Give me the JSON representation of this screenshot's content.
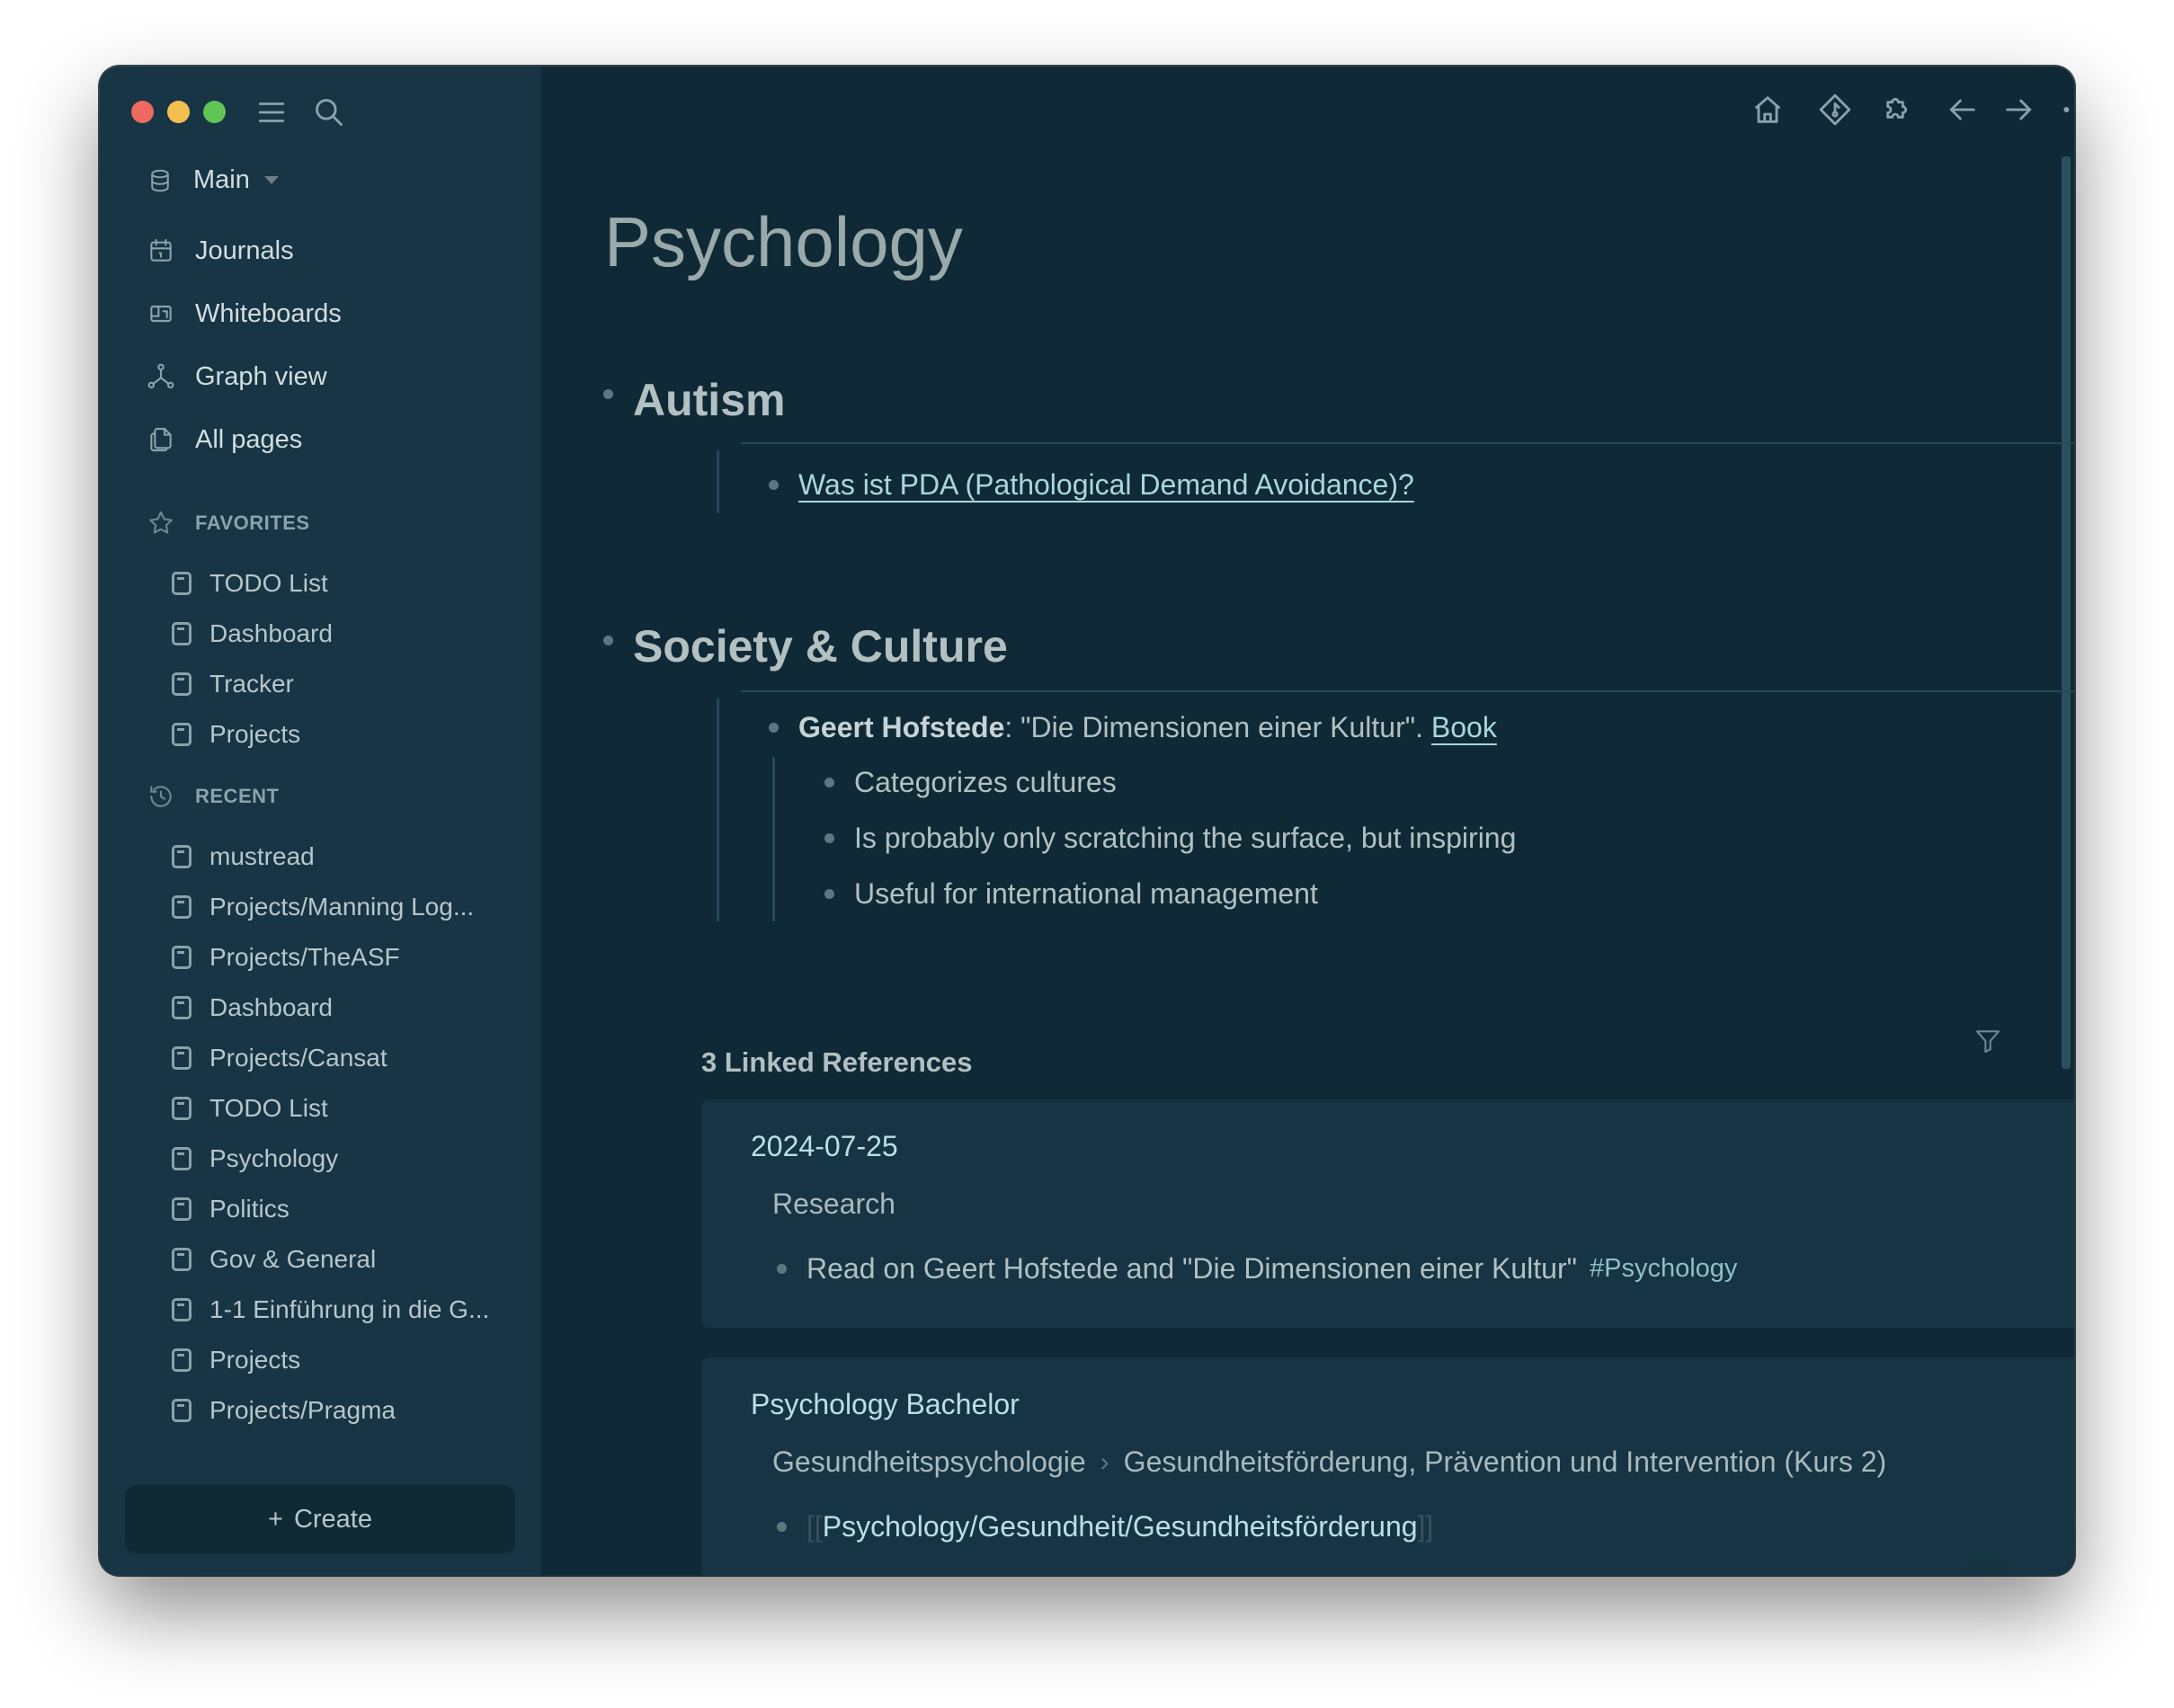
{
  "window": {
    "traffic_lights": [
      "close",
      "minimize",
      "zoom"
    ]
  },
  "sidebar": {
    "graph_name": "Main",
    "nav": [
      {
        "label": "Journals",
        "icon": "calendar-icon"
      },
      {
        "label": "Whiteboards",
        "icon": "whiteboard-icon"
      },
      {
        "label": "Graph view",
        "icon": "graph-icon"
      },
      {
        "label": "All pages",
        "icon": "pages-icon"
      }
    ],
    "favorites": {
      "title": "FAVORITES",
      "items": [
        "TODO List",
        "Dashboard",
        "Tracker",
        "Projects"
      ]
    },
    "recent": {
      "title": "RECENT",
      "items": [
        "mustread",
        "Projects/Manning Log...",
        "Projects/TheASF",
        "Dashboard",
        "Projects/Cansat",
        "TODO List",
        "Psychology",
        "Politics",
        "Gov & General",
        "1-1 Einführung in die G...",
        "Projects",
        "Projects/Pragma"
      ]
    },
    "create_label": "Create"
  },
  "toolbar": {
    "icons": [
      "home-icon",
      "git-icon",
      "plugins-icon",
      "back-icon",
      "forward-icon",
      "more-icon",
      "right-sidebar-icon"
    ]
  },
  "page": {
    "title": "Psychology",
    "sections": [
      {
        "heading": "Autism",
        "items": [
          {
            "link": "Was ist PDA (Pathological Demand Avoidance)?"
          }
        ]
      },
      {
        "heading": "Society & Culture",
        "items": [
          {
            "bold": "Geert Hofstede",
            "text": ": \"Die Dimensionen einer Kultur\". ",
            "link": "Book",
            "children": [
              "Categorizes cultures",
              "Is probably only scratching the surface, but inspiring",
              "Useful for international management"
            ]
          }
        ]
      }
    ]
  },
  "linked_references": {
    "title": "3 Linked References",
    "cards": [
      {
        "page": "2024-07-25",
        "breadcrumb": [
          "Research"
        ],
        "text": "Read on Geert Hofstede and \"Die Dimensionen einer Kultur\"",
        "tag": "#Psychology"
      },
      {
        "page": "Psychology Bachelor",
        "breadcrumb": [
          "Gesundheitspsychologie",
          "Gesundheitsförderung, Prävention und Intervention (Kurs 2)"
        ],
        "bracket_open": "[[",
        "link": "Psychology/Gesundheit/Gesundheitsförderung",
        "bracket_close": "]]"
      }
    ]
  },
  "help_label": "?",
  "colors": {
    "sidebar_bg": "#173544",
    "main_bg": "#0f2a36",
    "card_bg": "#163443",
    "link": "#a9d7de"
  }
}
